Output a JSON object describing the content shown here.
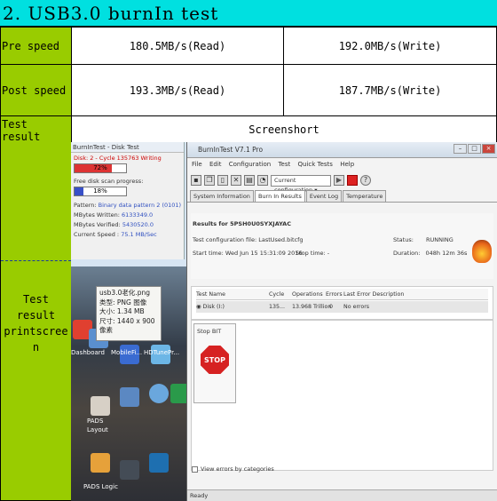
{
  "title": "2. USB3.0 burnIn test",
  "rows": {
    "pre_speed": {
      "label": "Pre speed",
      "read": "180.5MB/s(Read)",
      "write": "192.0MB/s(Write)"
    },
    "post_speed": {
      "label": "Post speed",
      "read": "193.3MB/s(Read)",
      "write": "187.7MB/s(Write)"
    },
    "test_result": {
      "label": "Test result",
      "value": "Screenshort"
    },
    "printscreen": {
      "label_lines": [
        "Test",
        "result",
        "printscree",
        "n"
      ]
    }
  },
  "screenshot": {
    "disk_test": {
      "title": "BurnInTest - Disk Test",
      "disk_line": "Disk: 2 - Cycle 135763 Writing",
      "progress1": "72%",
      "progress1_value": 0.72,
      "scan_label": "Free disk scan progress:",
      "progress2": "18%",
      "progress2_value": 0.18,
      "fields": [
        {
          "k": "Pattern:",
          "v": "Binary data pattern 2 (0101)"
        },
        {
          "k": "MBytes Written:",
          "v": "6133349.0"
        },
        {
          "k": "MBytes Verified:",
          "v": "5430520.0"
        },
        {
          "k": "Current Speed :",
          "v": "75.1 MB/Sec"
        }
      ]
    },
    "tooltip": {
      "name": "usb3.0老化.png",
      "type": "类型: PNG 图像",
      "size": "大小: 1.34 MB",
      "dims": "尺寸: 1440 x 900 像素"
    },
    "desktop_labels": [
      "Dashboard",
      "PADS",
      "Layout",
      "PADS Logic",
      "MobileFi...",
      "HDTunePr..."
    ],
    "burnintest": {
      "title": "BurnInTest V7.1 Pro",
      "menu": [
        "File",
        "Edit",
        "Configuration",
        "Test",
        "Quick Tests",
        "Help"
      ],
      "config_select": "Current configuration",
      "tabs": [
        "System Information",
        "Burn In Results",
        "Event Log",
        "Temperature"
      ],
      "results_for": "Results for 5PSH0U0SYXJAYAC",
      "config_file_label": "Test configuration file:",
      "config_file": "LastUsed.bitcfg",
      "start_label": "Start time:",
      "start_time": "Wed Jun 15 15:31:09 2016",
      "stop_label": "Stop time:",
      "stop_time": "-",
      "status_label": "Status:",
      "status": "RUNNING",
      "duration_label": "Duration:",
      "duration": "048h 12m 36s",
      "grid_headers": [
        "Test Name",
        "Cycle",
        "Operations",
        "Errors",
        "Last Error Description"
      ],
      "grid_row": [
        "Disk (I:)",
        "135...",
        "13.968 Trillion",
        "0",
        "No errors"
      ],
      "stop_bit": "Stop BIT",
      "stop_sign": "STOP",
      "view_errors": "View errors by categories",
      "status_bar": "Ready"
    }
  },
  "colors": {
    "title_bg": "#00e0e0",
    "label_bg": "#99cc00"
  }
}
